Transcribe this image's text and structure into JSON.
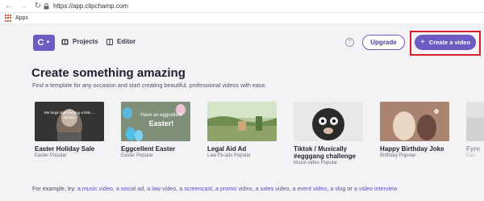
{
  "browser": {
    "url": "https://app.clipchamp.com",
    "bookmark_apps": "Apps"
  },
  "header": {
    "logo_letter": "C",
    "tabs": [
      {
        "label": "Projects"
      },
      {
        "label": "Editor"
      }
    ],
    "help_symbol": "?",
    "upgrade_label": "Upgrade",
    "create_label": "Create a video",
    "accent_color": "#6b5cc3",
    "highlight_color": "#d8202a"
  },
  "hero": {
    "title": "Create something amazing",
    "subtitle": "Find a template for any occasion and start creating beautiful, professional videos with ease."
  },
  "templates": [
    {
      "title": "Easter Holiday Sale",
      "meta": "Easter Popular",
      "thumb_text": "We begin this morning a little ... classic!"
    },
    {
      "title": "Eggcellent Easter",
      "meta": "Easter Popular",
      "thumb_text_1": "Have an eggcellent",
      "thumb_text_2": "Easter!"
    },
    {
      "title": "Legal Aid Ad",
      "meta": "Law Fb-ads Popular"
    },
    {
      "title": "Tiktok / Musically #egggang challenge",
      "title_line1": "Tiktok / Musically",
      "title_line2": "#egggang challenge",
      "meta": "Music-video Popular"
    },
    {
      "title": "Happy Birthday Joke",
      "meta": "Birthday Popular"
    },
    {
      "title": "Fyre",
      "meta": "Eas"
    }
  ],
  "examples": {
    "prefix": "For example, try:",
    "links": [
      "a music video",
      "a social ad",
      "a law video",
      "a screencast",
      "a promo video",
      "a sales video",
      "a event video",
      "a vlog",
      "a video interview"
    ],
    "separator": ", ",
    "last_joiner": " or "
  }
}
